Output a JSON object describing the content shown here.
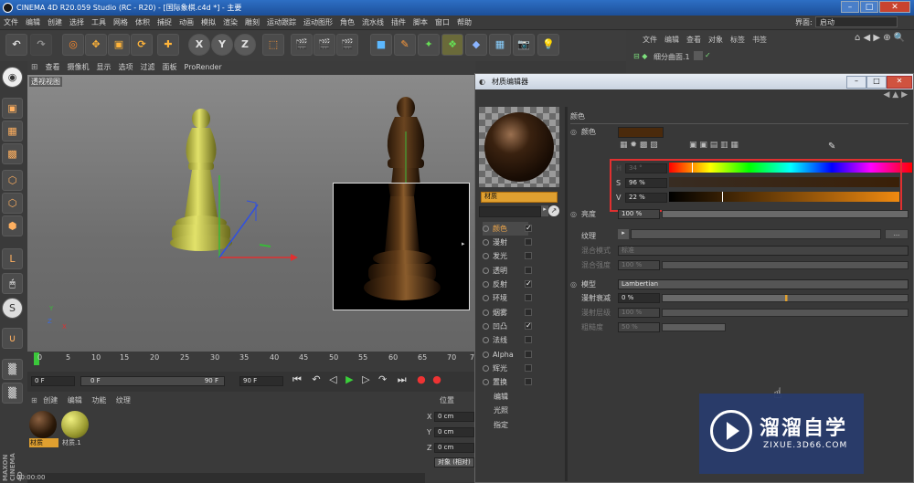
{
  "window": {
    "title": "CINEMA 4D R20.059 Studio (RC - R20) - [国际象棋.c4d *] - 主要",
    "layout_label": "界面:",
    "layout_value": "启动"
  },
  "menu": [
    "文件",
    "编辑",
    "创建",
    "选择",
    "工具",
    "网格",
    "体积",
    "捕捉",
    "动画",
    "模拟",
    "渲染",
    "雕刻",
    "运动跟踪",
    "运动图形",
    "角色",
    "流水线",
    "插件",
    "脚本",
    "窗口",
    "帮助"
  ],
  "toolbar": {
    "x_label": "X",
    "y_label": "Y",
    "z_label": "Z"
  },
  "object_manager": {
    "menu": [
      "文件",
      "编辑",
      "查看",
      "对象",
      "标签",
      "书签"
    ],
    "item": "细分曲面.1"
  },
  "viewport": {
    "menu": [
      "查看",
      "摄像机",
      "显示",
      "选项",
      "过滤",
      "面板",
      "ProRender"
    ],
    "label": "透视视图",
    "axis": {
      "y": "Y",
      "z": "Z",
      "x": "X"
    }
  },
  "timeline": {
    "ticks": [
      "0",
      "5",
      "10",
      "15",
      "20",
      "25",
      "30",
      "35",
      "40",
      "45",
      "50",
      "55",
      "60",
      "65",
      "70",
      "75"
    ],
    "start": "0 F",
    "current": "0 F",
    "end_a": "90 F",
    "end_b": "90 F"
  },
  "material_manager": {
    "menu": [
      "创建",
      "编辑",
      "功能",
      "纹理"
    ],
    "materials": [
      {
        "name": "材质"
      },
      {
        "name": "材质.1"
      }
    ]
  },
  "coords": {
    "title": "位置",
    "x_label": "X",
    "y_label": "Y",
    "z_label": "Z",
    "x": "0 cm",
    "y": "0 cm",
    "z": "0 cm",
    "button": "对象 (相对)"
  },
  "statusbar": {
    "time": "00:00:00"
  },
  "sidebar_brand": "MAXON CINEMA 4D",
  "material_editor": {
    "title": "材质编辑器",
    "material_name": "材质",
    "section": "颜色",
    "color_label": "颜色",
    "color_hex": "#4a2a0c",
    "h_label": "H",
    "h_value": "34 °",
    "s_label": "S",
    "s_value": "96 %",
    "v_label": "V",
    "v_value": "22 %",
    "brightness_label": "亮度",
    "brightness_value": "100 %",
    "texture_label": "纹理",
    "blend_mode_label": "混合模式",
    "blend_mode_value": "标准",
    "blend_strength_label": "混合强度",
    "blend_strength_value": "100 %",
    "model_label": "模型",
    "model_value": "Lambertian",
    "diffuse_falloff_label": "漫射衰减",
    "diffuse_falloff_value": "0 %",
    "diffuse_level_label": "漫射层级",
    "diffuse_level_value": "100 %",
    "roughness_label": "粗糙度",
    "roughness_value": "50 %",
    "channels": [
      {
        "name": "颜色",
        "checked": true,
        "active": true
      },
      {
        "name": "漫射",
        "checked": false
      },
      {
        "name": "发光",
        "checked": false
      },
      {
        "name": "透明",
        "checked": false
      },
      {
        "name": "反射",
        "checked": true
      },
      {
        "name": "环境",
        "checked": false
      },
      {
        "name": "烟雾",
        "checked": false
      },
      {
        "name": "凹凸",
        "checked": true
      },
      {
        "name": "法线",
        "checked": false
      },
      {
        "name": "Alpha",
        "checked": false
      },
      {
        "name": "辉光",
        "checked": false
      },
      {
        "name": "置换",
        "checked": false
      }
    ],
    "extra": [
      "编辑",
      "光照",
      "指定"
    ]
  },
  "watermark": {
    "title": "溜溜自学",
    "url": "ZIXUE.3D66.COM"
  },
  "colors": {
    "highlight_box": "#e03030",
    "accent": "#e0a030"
  }
}
